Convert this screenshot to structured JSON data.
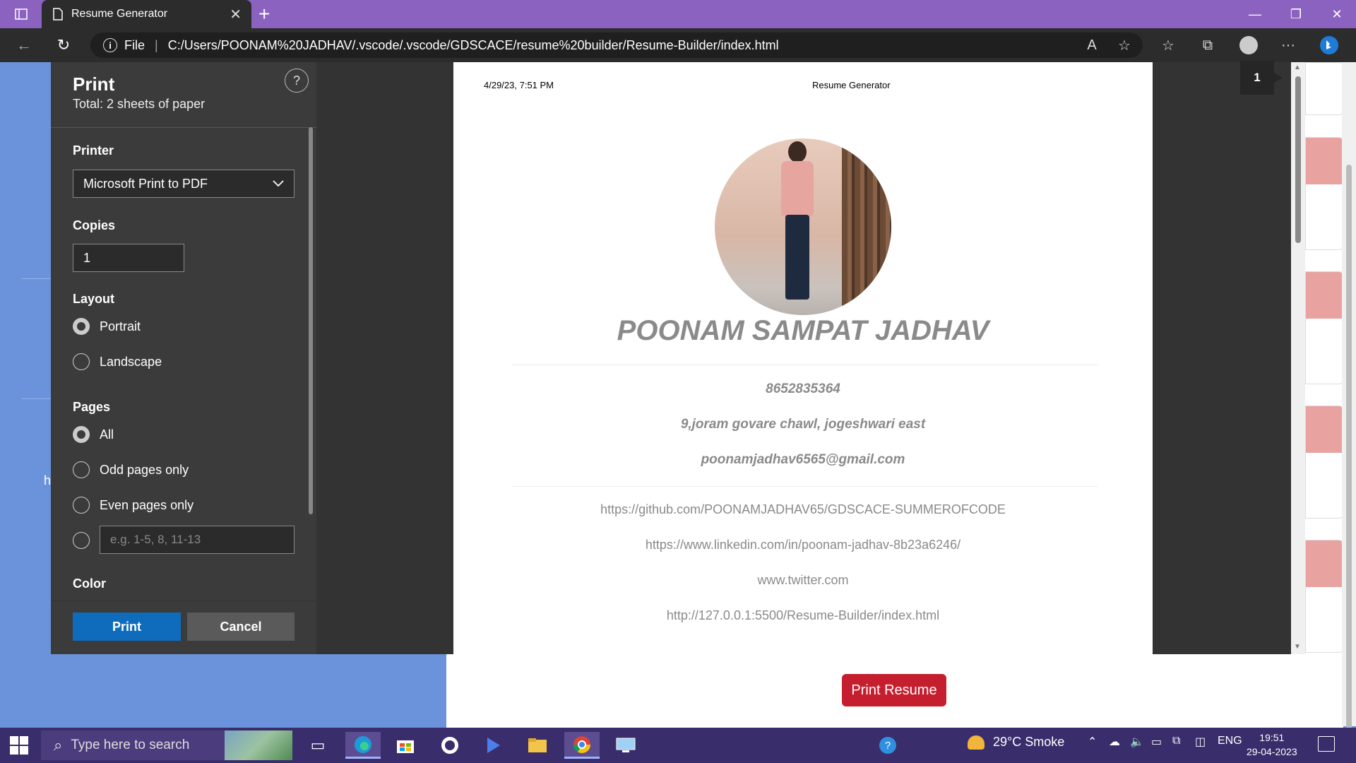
{
  "browser": {
    "tab_title": "Resume Generator",
    "url_scheme": "File",
    "url": "C:/Users/POONAM%20JADHAV/.vscode/.vscode/GDSCACE/resume%20builder/Resume-Builder/index.html"
  },
  "print_dialog": {
    "title": "Print",
    "total": "Total: 2 sheets of paper",
    "help": "?",
    "printer_label": "Printer",
    "printer_value": "Microsoft Print to PDF",
    "copies_label": "Copies",
    "copies_value": "1",
    "layout_label": "Layout",
    "layout_options": [
      "Portrait",
      "Landscape"
    ],
    "pages_label": "Pages",
    "pages_options": [
      "All",
      "Odd pages only",
      "Even pages only"
    ],
    "pages_custom_placeholder": "e.g. 1-5, 8, 11-13",
    "color_label": "Color",
    "print_button": "Print",
    "cancel_button": "Cancel"
  },
  "preview": {
    "header_date": "4/29/23, 7:51 PM",
    "header_title": "Resume Generator",
    "page_number": "1",
    "name": "POONAM SAMPAT JADHAV",
    "phone": "8652835364",
    "address": "9,joram govare chawl, jogeshwari east",
    "email": "poonamjadhav6565@gmail.com",
    "links": [
      "https://github.com/POONAMJADHAV65/GDSCACE-SUMMEROFCODE",
      "https://www.linkedin.com/in/poonam-jadhav-8b23a6246/",
      "www.twitter.com",
      "http://127.0.0.1:5500/Resume-Builder/index.html"
    ]
  },
  "page_bg": {
    "print_resume_button": "Print Resume",
    "left_letter": "h"
  },
  "taskbar": {
    "search_placeholder": "Type here to search",
    "weather": "29°C  Smoke",
    "language": "ENG",
    "time": "19:51",
    "date": "29-04-2023"
  }
}
